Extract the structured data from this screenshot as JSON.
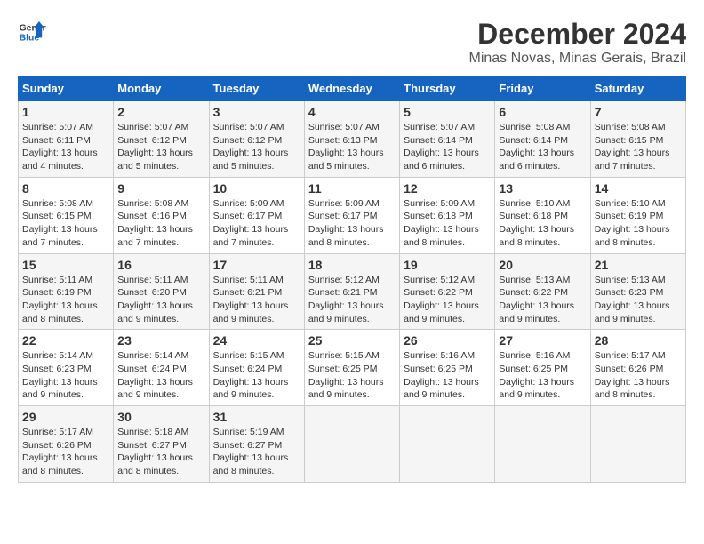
{
  "logo": {
    "text_general": "General",
    "text_blue": "Blue"
  },
  "title": {
    "month": "December 2024",
    "location": "Minas Novas, Minas Gerais, Brazil"
  },
  "weekdays": [
    "Sunday",
    "Monday",
    "Tuesday",
    "Wednesday",
    "Thursday",
    "Friday",
    "Saturday"
  ],
  "weeks": [
    [
      {
        "day": "1",
        "sunrise": "Sunrise: 5:07 AM",
        "sunset": "Sunset: 6:11 PM",
        "daylight": "Daylight: 13 hours and 4 minutes."
      },
      {
        "day": "2",
        "sunrise": "Sunrise: 5:07 AM",
        "sunset": "Sunset: 6:12 PM",
        "daylight": "Daylight: 13 hours and 5 minutes."
      },
      {
        "day": "3",
        "sunrise": "Sunrise: 5:07 AM",
        "sunset": "Sunset: 6:12 PM",
        "daylight": "Daylight: 13 hours and 5 minutes."
      },
      {
        "day": "4",
        "sunrise": "Sunrise: 5:07 AM",
        "sunset": "Sunset: 6:13 PM",
        "daylight": "Daylight: 13 hours and 5 minutes."
      },
      {
        "day": "5",
        "sunrise": "Sunrise: 5:07 AM",
        "sunset": "Sunset: 6:14 PM",
        "daylight": "Daylight: 13 hours and 6 minutes."
      },
      {
        "day": "6",
        "sunrise": "Sunrise: 5:08 AM",
        "sunset": "Sunset: 6:14 PM",
        "daylight": "Daylight: 13 hours and 6 minutes."
      },
      {
        "day": "7",
        "sunrise": "Sunrise: 5:08 AM",
        "sunset": "Sunset: 6:15 PM",
        "daylight": "Daylight: 13 hours and 7 minutes."
      }
    ],
    [
      {
        "day": "8",
        "sunrise": "Sunrise: 5:08 AM",
        "sunset": "Sunset: 6:15 PM",
        "daylight": "Daylight: 13 hours and 7 minutes."
      },
      {
        "day": "9",
        "sunrise": "Sunrise: 5:08 AM",
        "sunset": "Sunset: 6:16 PM",
        "daylight": "Daylight: 13 hours and 7 minutes."
      },
      {
        "day": "10",
        "sunrise": "Sunrise: 5:09 AM",
        "sunset": "Sunset: 6:17 PM",
        "daylight": "Daylight: 13 hours and 7 minutes."
      },
      {
        "day": "11",
        "sunrise": "Sunrise: 5:09 AM",
        "sunset": "Sunset: 6:17 PM",
        "daylight": "Daylight: 13 hours and 8 minutes."
      },
      {
        "day": "12",
        "sunrise": "Sunrise: 5:09 AM",
        "sunset": "Sunset: 6:18 PM",
        "daylight": "Daylight: 13 hours and 8 minutes."
      },
      {
        "day": "13",
        "sunrise": "Sunrise: 5:10 AM",
        "sunset": "Sunset: 6:18 PM",
        "daylight": "Daylight: 13 hours and 8 minutes."
      },
      {
        "day": "14",
        "sunrise": "Sunrise: 5:10 AM",
        "sunset": "Sunset: 6:19 PM",
        "daylight": "Daylight: 13 hours and 8 minutes."
      }
    ],
    [
      {
        "day": "15",
        "sunrise": "Sunrise: 5:11 AM",
        "sunset": "Sunset: 6:19 PM",
        "daylight": "Daylight: 13 hours and 8 minutes."
      },
      {
        "day": "16",
        "sunrise": "Sunrise: 5:11 AM",
        "sunset": "Sunset: 6:20 PM",
        "daylight": "Daylight: 13 hours and 9 minutes."
      },
      {
        "day": "17",
        "sunrise": "Sunrise: 5:11 AM",
        "sunset": "Sunset: 6:21 PM",
        "daylight": "Daylight: 13 hours and 9 minutes."
      },
      {
        "day": "18",
        "sunrise": "Sunrise: 5:12 AM",
        "sunset": "Sunset: 6:21 PM",
        "daylight": "Daylight: 13 hours and 9 minutes."
      },
      {
        "day": "19",
        "sunrise": "Sunrise: 5:12 AM",
        "sunset": "Sunset: 6:22 PM",
        "daylight": "Daylight: 13 hours and 9 minutes."
      },
      {
        "day": "20",
        "sunrise": "Sunrise: 5:13 AM",
        "sunset": "Sunset: 6:22 PM",
        "daylight": "Daylight: 13 hours and 9 minutes."
      },
      {
        "day": "21",
        "sunrise": "Sunrise: 5:13 AM",
        "sunset": "Sunset: 6:23 PM",
        "daylight": "Daylight: 13 hours and 9 minutes."
      }
    ],
    [
      {
        "day": "22",
        "sunrise": "Sunrise: 5:14 AM",
        "sunset": "Sunset: 6:23 PM",
        "daylight": "Daylight: 13 hours and 9 minutes."
      },
      {
        "day": "23",
        "sunrise": "Sunrise: 5:14 AM",
        "sunset": "Sunset: 6:24 PM",
        "daylight": "Daylight: 13 hours and 9 minutes."
      },
      {
        "day": "24",
        "sunrise": "Sunrise: 5:15 AM",
        "sunset": "Sunset: 6:24 PM",
        "daylight": "Daylight: 13 hours and 9 minutes."
      },
      {
        "day": "25",
        "sunrise": "Sunrise: 5:15 AM",
        "sunset": "Sunset: 6:25 PM",
        "daylight": "Daylight: 13 hours and 9 minutes."
      },
      {
        "day": "26",
        "sunrise": "Sunrise: 5:16 AM",
        "sunset": "Sunset: 6:25 PM",
        "daylight": "Daylight: 13 hours and 9 minutes."
      },
      {
        "day": "27",
        "sunrise": "Sunrise: 5:16 AM",
        "sunset": "Sunset: 6:25 PM",
        "daylight": "Daylight: 13 hours and 9 minutes."
      },
      {
        "day": "28",
        "sunrise": "Sunrise: 5:17 AM",
        "sunset": "Sunset: 6:26 PM",
        "daylight": "Daylight: 13 hours and 8 minutes."
      }
    ],
    [
      {
        "day": "29",
        "sunrise": "Sunrise: 5:17 AM",
        "sunset": "Sunset: 6:26 PM",
        "daylight": "Daylight: 13 hours and 8 minutes."
      },
      {
        "day": "30",
        "sunrise": "Sunrise: 5:18 AM",
        "sunset": "Sunset: 6:27 PM",
        "daylight": "Daylight: 13 hours and 8 minutes."
      },
      {
        "day": "31",
        "sunrise": "Sunrise: 5:19 AM",
        "sunset": "Sunset: 6:27 PM",
        "daylight": "Daylight: 13 hours and 8 minutes."
      },
      null,
      null,
      null,
      null
    ]
  ]
}
